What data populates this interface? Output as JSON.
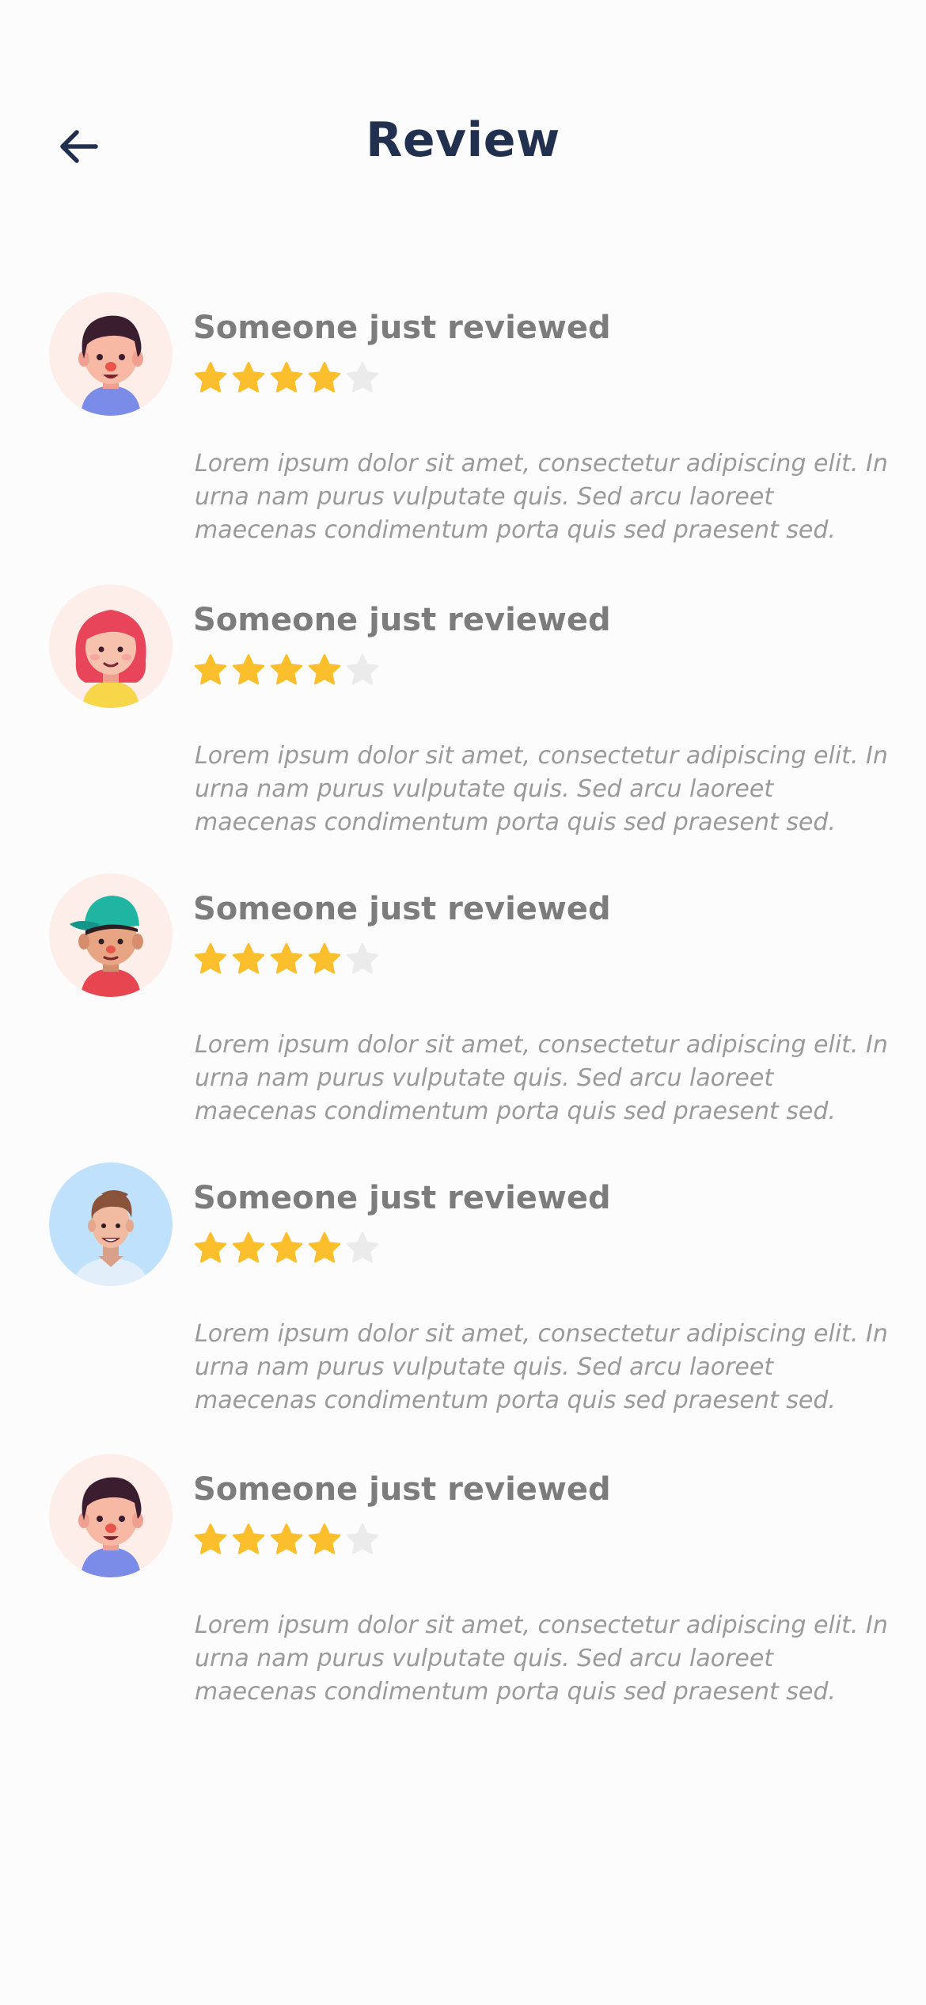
{
  "header": {
    "title": "Review",
    "back_icon": "arrow-left-icon"
  },
  "colors": {
    "title": "#22304f",
    "star_filled": "#fbbf2d",
    "star_empty": "#ebebeb",
    "review_title": "#7c7c7c",
    "review_text": "#9a9a9a"
  },
  "reviews": [
    {
      "title": "Someone just reviewed",
      "rating": 4,
      "max_rating": 5,
      "text": "Lorem ipsum dolor sit amet, consectetur adipiscing elit. In urna nam purus vulputate quis. Sed arcu laoreet maecenas condimentum porta quis sed praesent sed.",
      "avatar": "avatar-boy-dark-hair-icon"
    },
    {
      "title": "Someone just reviewed",
      "rating": 4,
      "max_rating": 5,
      "text": "Lorem ipsum dolor sit amet, consectetur adipiscing elit. In urna nam purus vulputate quis. Sed arcu laoreet maecenas condimentum porta quis sed praesent sed.",
      "avatar": "avatar-girl-red-hair-icon"
    },
    {
      "title": "Someone just reviewed",
      "rating": 4,
      "max_rating": 5,
      "text": "Lorem ipsum dolor sit amet, consectetur adipiscing elit. In urna nam purus vulputate quis. Sed arcu laoreet maecenas condimentum porta quis sed praesent sed.",
      "avatar": "avatar-boy-cap-icon"
    },
    {
      "title": "Someone just reviewed",
      "rating": 4,
      "max_rating": 5,
      "text": "Lorem ipsum dolor sit amet, consectetur adipiscing elit. In urna nam purus vulputate quis. Sed arcu laoreet maecenas condimentum porta quis sed praesent sed.",
      "avatar": "avatar-man-brown-hair-icon"
    },
    {
      "title": "Someone just reviewed",
      "rating": 4,
      "max_rating": 5,
      "text": "Lorem ipsum dolor sit amet, consectetur adipiscing elit. In urna nam purus vulputate quis. Sed arcu laoreet maecenas condimentum porta quis sed praesent sed.",
      "avatar": "avatar-boy-dark-hair-icon"
    }
  ]
}
